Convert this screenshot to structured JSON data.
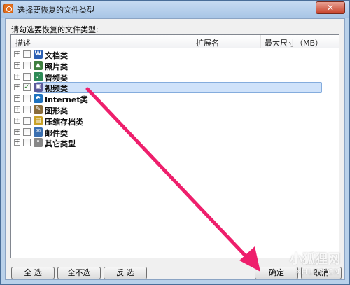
{
  "window": {
    "title": "选择要恢复的文件类型",
    "close": "✕"
  },
  "prompt": "请勾选要恢复的文件类型:",
  "columns": [
    "描述",
    "扩展名",
    "最大尺寸（MB）"
  ],
  "items": [
    {
      "label": "文档类",
      "icon": "word-doc-icon",
      "icon_glyph": "W",
      "icon_color": "#2b5fb3",
      "checked": false,
      "selected": false
    },
    {
      "label": "照片类",
      "icon": "photo-icon",
      "icon_glyph": "▲",
      "icon_color": "#3f7f3f",
      "checked": false,
      "selected": false
    },
    {
      "label": "音频类",
      "icon": "audio-icon",
      "icon_glyph": "♪",
      "icon_color": "#2e8b57",
      "checked": false,
      "selected": false
    },
    {
      "label": "视频类",
      "icon": "video-icon",
      "icon_glyph": "▣",
      "icon_color": "#5a5a9a",
      "checked": true,
      "selected": true
    },
    {
      "label": "Internet类",
      "icon": "internet-explorer-icon",
      "icon_glyph": "e",
      "icon_color": "#1e73be",
      "checked": false,
      "selected": false
    },
    {
      "label": "图形类",
      "icon": "graphics-icon",
      "icon_glyph": "✎",
      "icon_color": "#8a6d3b",
      "checked": false,
      "selected": false
    },
    {
      "label": "压缩存档类",
      "icon": "archive-icon",
      "icon_glyph": "▤",
      "icon_color": "#c9a227",
      "checked": false,
      "selected": false
    },
    {
      "label": "邮件类",
      "icon": "mail-icon",
      "icon_glyph": "✉",
      "icon_color": "#3a6fb0",
      "checked": false,
      "selected": false
    },
    {
      "label": "其它类型",
      "icon": "other-file-icon",
      "icon_glyph": "•",
      "icon_color": "#888888",
      "checked": false,
      "selected": false
    }
  ],
  "buttons": {
    "select_all": "全 选",
    "select_none": "全不选",
    "invert": "反 选",
    "ok": "确定",
    "cancel": "取消"
  },
  "watermark": {
    "title": "小狐狸网",
    "url": "XHLKS.CN"
  },
  "colors": {
    "arrow": "#ee1f6c",
    "selection": "#cfe2fa"
  }
}
